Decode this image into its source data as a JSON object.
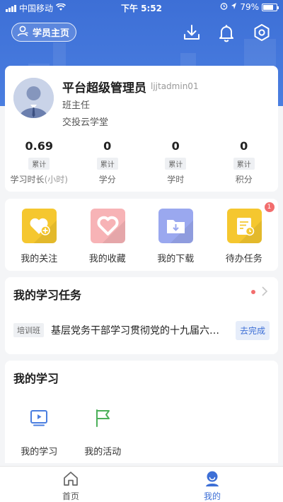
{
  "status_bar": {
    "carrier": "中国移动",
    "time": "下午 5:52",
    "battery": "79%",
    "battery_level": 0.79
  },
  "header": {
    "home_button_label": "学员主页",
    "icons": [
      "download-icon",
      "bell-icon",
      "settings-icon"
    ]
  },
  "profile": {
    "name": "平台超级管理员",
    "login": "ljjtadmin01",
    "role": "班主任",
    "org": "交投云学堂",
    "stats": [
      {
        "value": "0.69",
        "tag": "累计",
        "label": "学习时长",
        "unit": "(小时)"
      },
      {
        "value": "0",
        "tag": "累计",
        "label": "学分",
        "unit": ""
      },
      {
        "value": "0",
        "tag": "累计",
        "label": "学时",
        "unit": ""
      },
      {
        "value": "0",
        "tag": "累计",
        "label": "积分",
        "unit": ""
      }
    ]
  },
  "quick_links": [
    {
      "label": "我的关注",
      "icon": "heart-plus-icon",
      "color": "#f5c72f"
    },
    {
      "label": "我的收藏",
      "icon": "heart-icon",
      "color": "#f7b3b6"
    },
    {
      "label": "我的下载",
      "icon": "folder-download-icon",
      "color": "#9aa8ef"
    },
    {
      "label": "待办任务",
      "icon": "task-clipboard-icon",
      "color": "#f5c72f",
      "badge": "1"
    }
  ],
  "tasks": {
    "title": "我的学习任务",
    "items": [
      {
        "tag": "培训班",
        "text": "基层党务干部学习贯彻党的十九届六中全会精神",
        "action": "去完成"
      }
    ]
  },
  "study": {
    "title": "我的学习",
    "items": [
      {
        "label": "我的学习",
        "icon": "video-play-icon"
      },
      {
        "label": "我的活动",
        "icon": "flag-icon"
      }
    ]
  },
  "tabbar": {
    "items": [
      {
        "label": "首页",
        "icon": "home-icon",
        "active": false
      },
      {
        "label": "我的",
        "icon": "user-icon",
        "active": true
      }
    ]
  },
  "colors": {
    "accent": "#3d6fd6",
    "badge": "#f26d6d",
    "page_bg": "#f4f5f7"
  }
}
